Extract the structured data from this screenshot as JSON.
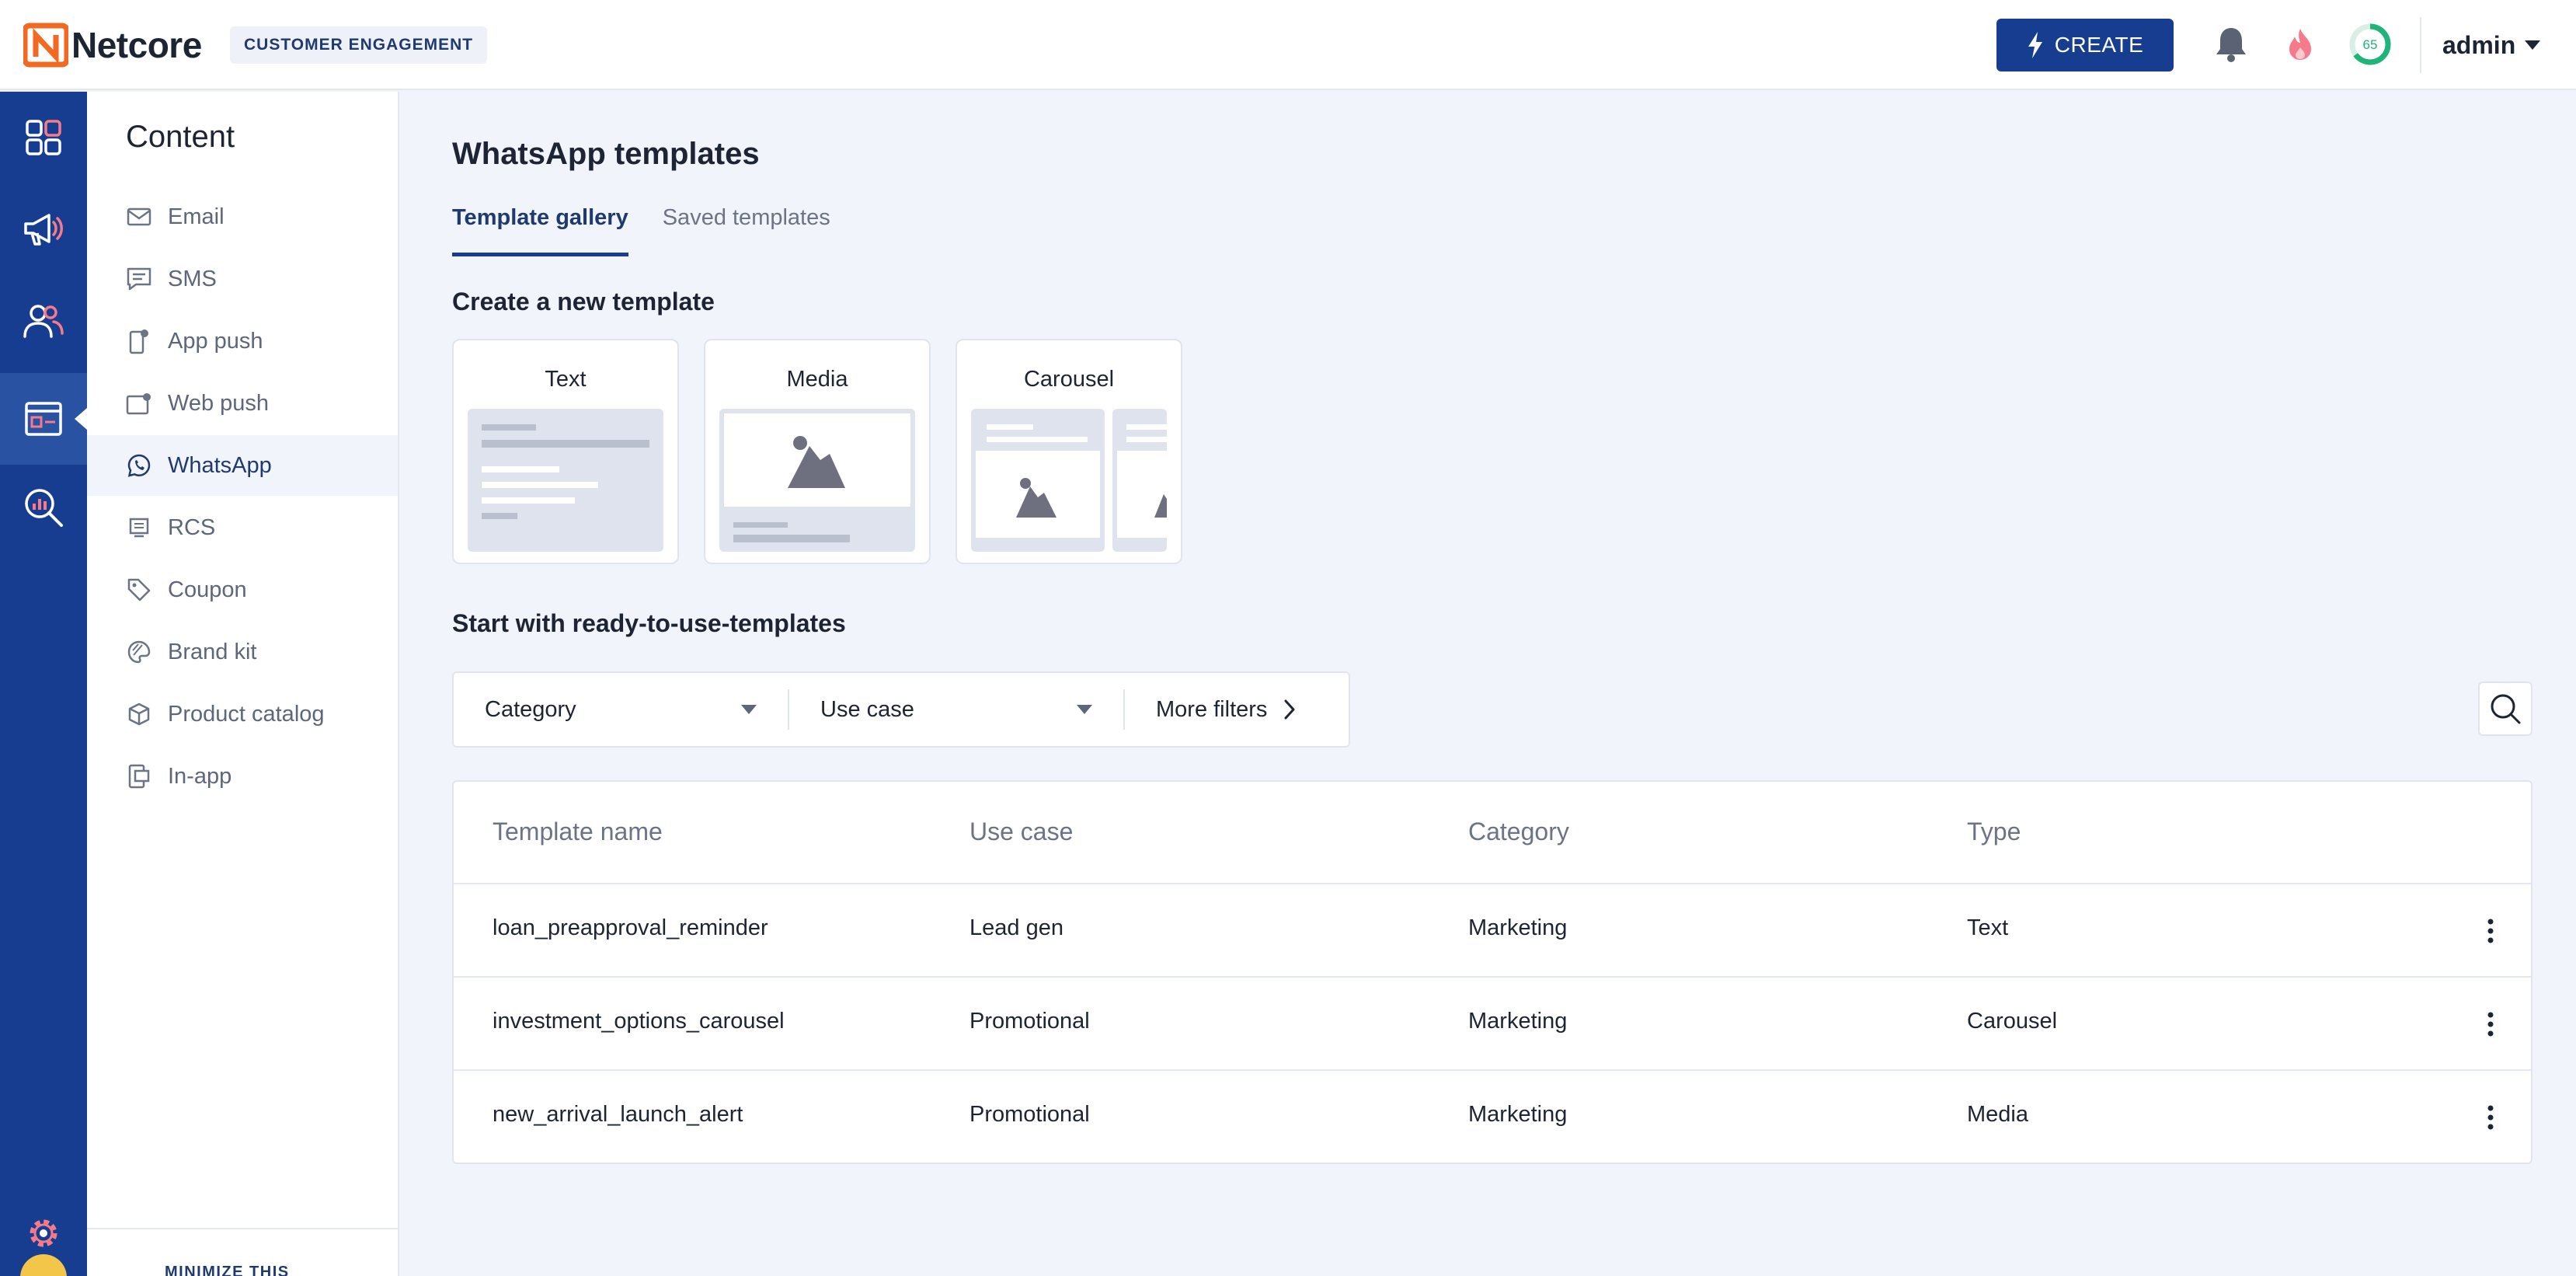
{
  "header": {
    "logo_text": "Netcore",
    "product_badge": "CUSTOMER ENGAGEMENT",
    "create_label": "CREATE",
    "score": "65",
    "user_name": "admin",
    "accent_color": "#163d8f"
  },
  "rail": {
    "icons": [
      "dashboard-icon",
      "megaphone-icon",
      "users-icon",
      "content-icon",
      "analytics-icon",
      "settings-icon"
    ]
  },
  "subnav": {
    "title": "Content",
    "items": [
      {
        "label": "Email",
        "icon": "mail-icon"
      },
      {
        "label": "SMS",
        "icon": "sms-icon"
      },
      {
        "label": "App push",
        "icon": "app-push-icon"
      },
      {
        "label": "Web push",
        "icon": "web-push-icon"
      },
      {
        "label": "WhatsApp",
        "icon": "whatsapp-icon",
        "active": true
      },
      {
        "label": "RCS",
        "icon": "rcs-icon"
      },
      {
        "label": "Coupon",
        "icon": "tag-icon"
      },
      {
        "label": "Brand kit",
        "icon": "palette-icon"
      },
      {
        "label": "Product catalog",
        "icon": "box-icon"
      },
      {
        "label": "In-app",
        "icon": "in-app-icon"
      }
    ],
    "minimize_label": "MINIMIZE THIS"
  },
  "main": {
    "title": "WhatsApp templates",
    "tabs": [
      {
        "label": "Template gallery",
        "active": true
      },
      {
        "label": "Saved templates",
        "active": false
      }
    ],
    "create_section_title": "Create a new template",
    "template_types": [
      "Text",
      "Media",
      "Carousel"
    ],
    "ready_section_title": "Start with ready-to-use-templates",
    "filters": {
      "category": "Category",
      "use_case": "Use case",
      "more": "More filters"
    },
    "table": {
      "columns": [
        "Template name",
        "Use case",
        "Category",
        "Type"
      ],
      "rows": [
        [
          "loan_preapproval_reminder",
          "Lead gen",
          "Marketing",
          "Text"
        ],
        [
          "investment_options_carousel",
          "Promotional",
          "Marketing",
          "Carousel"
        ],
        [
          "new_arrival_launch_alert",
          "Promotional",
          "Marketing",
          "Media"
        ]
      ]
    }
  }
}
